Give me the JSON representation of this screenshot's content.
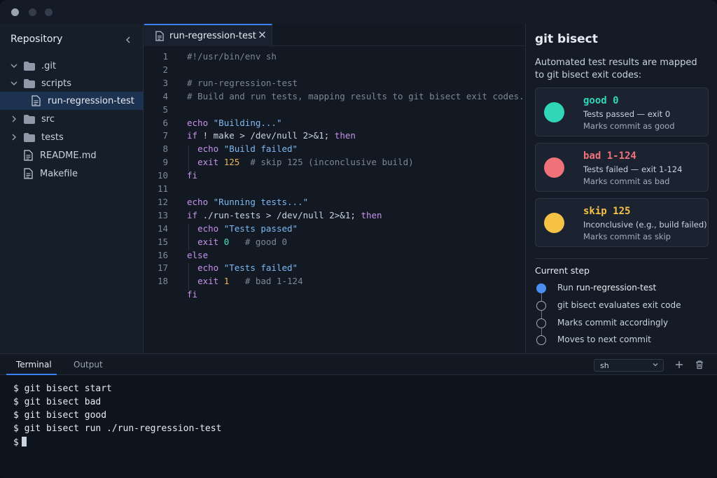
{
  "sidebar": {
    "title": "Repository",
    "items": [
      {
        "label": ".git",
        "type": "folder",
        "expanded": true,
        "depth": 0
      },
      {
        "label": "scripts",
        "type": "folder",
        "expanded": true,
        "depth": 0
      },
      {
        "label": "run-regression-test",
        "type": "file",
        "depth": 1,
        "selected": true
      },
      {
        "label": "src",
        "type": "folder",
        "expanded": false,
        "depth": 0
      },
      {
        "label": "tests",
        "type": "folder",
        "expanded": false,
        "depth": 0
      },
      {
        "label": "README.md",
        "type": "file",
        "depth": 0
      },
      {
        "label": "Makefile",
        "type": "file",
        "depth": 0
      }
    ]
  },
  "editor": {
    "tab_label": "run-regression-test",
    "line_numbers": [
      "1",
      "2",
      "3",
      "4",
      "5",
      "6",
      "7",
      "8",
      "9",
      "10",
      "11",
      "12",
      "13",
      "14",
      "15",
      "16",
      "17",
      "18"
    ],
    "code": [
      "#!/usr/bin/env sh",
      "",
      "# run-regression-test",
      "# Build and run tests, mapping results to git bisect exit codes.",
      "",
      "echo \"Building...\"",
      "if ! make > /dev/null 2>&1; then",
      "  echo \"Build failed\"",
      "  exit 125  # skip 125 (inconclusive build)",
      "fi",
      "",
      "echo \"Running tests...\"",
      "if ./run-tests > /dev/null 2>&1; then",
      "  echo \"Tests passed\"",
      "  exit 0   # good 0",
      "else",
      "  echo \"Tests failed\"",
      "  exit 1   # bad 1-124",
      "fi"
    ]
  },
  "panel": {
    "title": "git bisect",
    "description": "Automated test results are mapped to git bisect exit codes:",
    "cards": [
      {
        "title": "good  0",
        "line1": "Tests passed — exit 0",
        "line2": "Marks commit as good",
        "color": "#2fd6b8"
      },
      {
        "title": "bad  1-124",
        "line1": "Tests failed — exit 1-124",
        "line2": "Marks commit as bad",
        "color": "#f07178"
      },
      {
        "title": "skip  125",
        "line1": "Inconclusive (e.g., build failed)",
        "line2": "Marks commit as skip",
        "color": "#f5c246"
      }
    ],
    "current_step_label": "Current step",
    "steps": [
      {
        "text_prefix": "Run ",
        "text_strong": "run-regression-test",
        "active": true
      },
      {
        "text_prefix": "git bisect evaluates exit code",
        "text_strong": "",
        "active": false
      },
      {
        "text_prefix": "Marks commit accordingly",
        "text_strong": "",
        "active": false
      },
      {
        "text_prefix": "Moves to next commit",
        "text_strong": "",
        "active": false
      }
    ]
  },
  "bottom": {
    "tabs": [
      "Terminal",
      "Output"
    ],
    "shell_value": "sh",
    "terminal_lines": [
      "$ git bisect start",
      "$ git bisect bad",
      "$ git bisect good",
      "$ git bisect run ./run-regression-test",
      "$"
    ]
  },
  "colors": {
    "accent": "#3b82f6",
    "good": "#2fd6b8",
    "bad": "#f07178",
    "skip": "#f5c246"
  }
}
